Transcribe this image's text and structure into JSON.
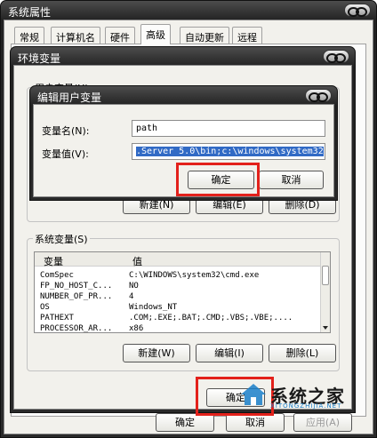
{
  "sysprops": {
    "title": "系统属性",
    "tabs": [
      "常规",
      "计算机名",
      "硬件",
      "高级",
      "自动更新",
      "远程"
    ],
    "buttons": {
      "ok": "确定",
      "cancel": "取消",
      "apply": "应用(A)"
    }
  },
  "envvars": {
    "title": "环境变量",
    "user_group_label": "用户变量(U)",
    "user_buttons": {
      "new": "新建(N)",
      "edit": "编辑(E)",
      "delete": "删除(D)"
    },
    "system_group_label": "系统变量(S)",
    "columns": {
      "variable": "变量",
      "value": "值"
    },
    "rows": [
      {
        "name": "ComSpec",
        "value": "C:\\WINDOWS\\system32\\cmd.exe"
      },
      {
        "name": "FP_NO_HOST_C...",
        "value": "NO"
      },
      {
        "name": "NUMBER_OF_PR...",
        "value": "4"
      },
      {
        "name": "OS",
        "value": "Windows_NT"
      },
      {
        "name": "PATHEXT",
        "value": ".COM;.EXE;.BAT;.CMD;.VBS;.VBE;...."
      },
      {
        "name": "PROCESSOR_AR...",
        "value": "x86"
      }
    ],
    "system_buttons": {
      "new": "新建(W)",
      "edit": "编辑(I)",
      "delete": "删除(L)"
    },
    "ok": "确定"
  },
  "edit_dialog": {
    "title": "编辑用户变量",
    "name_label": "变量名(N):",
    "name_value": "path",
    "value_label": "变量值(V):",
    "value_value": ".Server 5.0\\bin;c:\\windows\\system32",
    "ok": "确定",
    "cancel": "取消"
  },
  "watermark": {
    "main": "系统之家",
    "sub": "XITONGZHIJIA.NET"
  },
  "colors": {
    "highlight": "#e3211b",
    "selection": "#316ac5"
  }
}
